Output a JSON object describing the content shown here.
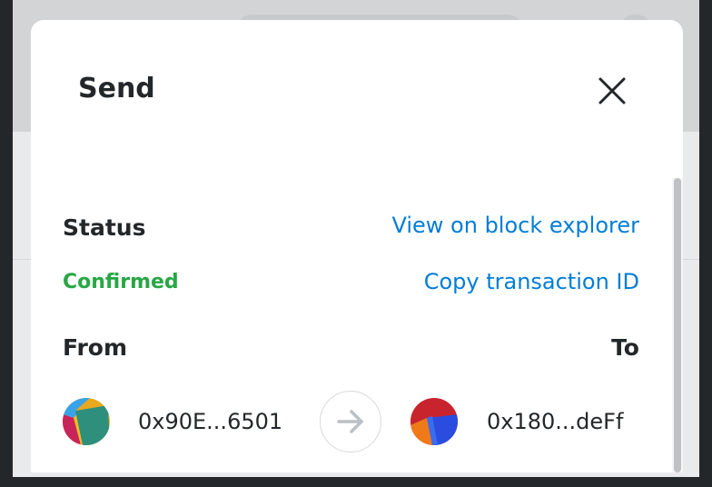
{
  "modal": {
    "title": "Send"
  },
  "status": {
    "label": "Status",
    "value": "Confirmed",
    "value_color": "#28a745"
  },
  "links": {
    "block_explorer": "View on block explorer",
    "copy_tx_id": "Copy transaction ID",
    "color": "#037dd6"
  },
  "transfer": {
    "from_label": "From",
    "to_label": "To",
    "from_address": "0x90E...6501",
    "to_address": "0x180...deFf",
    "from_avatar": "jazzicon-avatar",
    "to_avatar": "jazzicon-avatar",
    "arrow_icon": "arrow-right-icon"
  },
  "icons": {
    "close": "close-icon"
  }
}
